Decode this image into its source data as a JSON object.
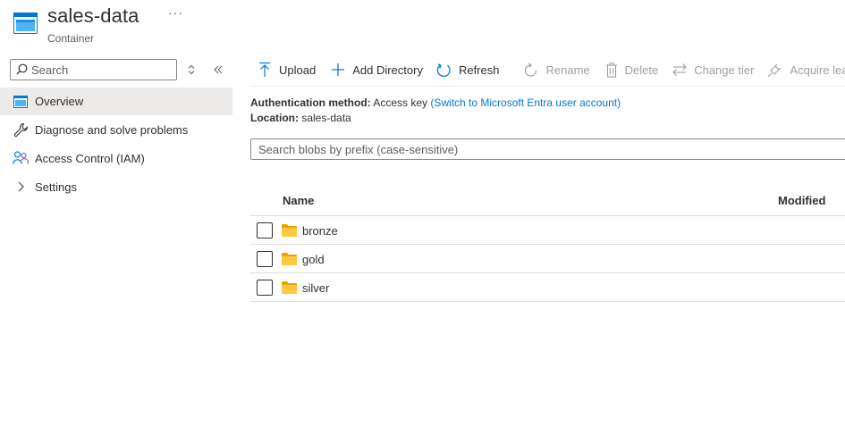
{
  "header": {
    "title": "sales-data",
    "subtitle": "Container",
    "more_label": "···"
  },
  "sidebar": {
    "search_placeholder": "Search",
    "items": [
      {
        "label": "Overview",
        "icon": "container-overview-icon",
        "active": true
      },
      {
        "label": "Diagnose and solve problems",
        "icon": "wrench-icon"
      },
      {
        "label": "Access Control (IAM)",
        "icon": "people-icon"
      },
      {
        "label": "Settings",
        "icon": "chevron-right-icon"
      }
    ]
  },
  "toolbar": {
    "upload": "Upload",
    "add_directory": "Add Directory",
    "refresh": "Refresh",
    "rename": "Rename",
    "delete": "Delete",
    "change_tier": "Change tier",
    "acquire_lease": "Acquire lease"
  },
  "info": {
    "auth_label": "Authentication method:",
    "auth_value": "Access key",
    "auth_link": "(Switch to Microsoft Entra user account)",
    "location_label": "Location:",
    "location_value": "sales-data"
  },
  "blob_search_placeholder": "Search blobs by prefix (case-sensitive)",
  "table": {
    "columns": [
      "Name",
      "Modified"
    ],
    "rows": [
      {
        "name": "bronze"
      },
      {
        "name": "gold"
      },
      {
        "name": "silver"
      }
    ]
  },
  "colors": {
    "accent": "#0078d4",
    "folder": "#ffc83d",
    "active_nav": "#edebe9"
  }
}
